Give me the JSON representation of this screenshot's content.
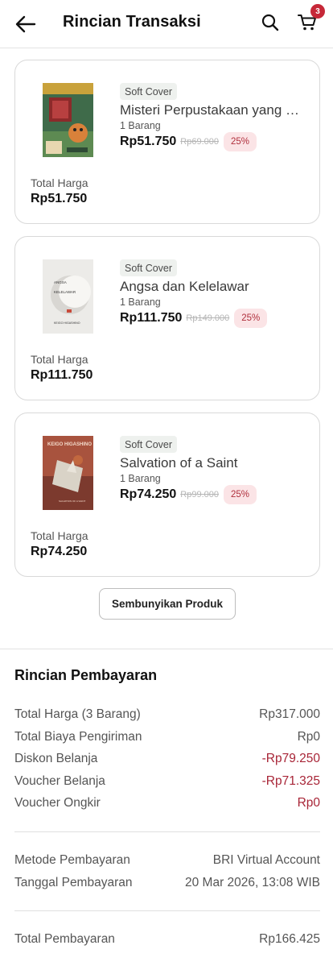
{
  "header": {
    "title": "Rincian Transaksi",
    "cart_count": "3"
  },
  "products": [
    {
      "type_badge": "Soft Cover",
      "title": "Misteri Perpustakaan yang Hilang",
      "qty": "1 Barang",
      "price": "Rp51.750",
      "original_price": "Rp69.000",
      "discount": "25%",
      "total_label": "Total Harga",
      "total_value": "Rp51.750"
    },
    {
      "type_badge": "Soft Cover",
      "title": "Angsa dan Kelelawar",
      "qty": "1 Barang",
      "price": "Rp111.750",
      "original_price": "Rp149.000",
      "discount": "25%",
      "total_label": "Total Harga",
      "total_value": "Rp111.750"
    },
    {
      "type_badge": "Soft Cover",
      "title": "Salvation of a Saint",
      "qty": "1 Barang",
      "price": "Rp74.250",
      "original_price": "Rp99.000",
      "discount": "25%",
      "total_label": "Total Harga",
      "total_value": "Rp74.250"
    }
  ],
  "hide_products_label": "Sembunyikan Produk",
  "payment": {
    "title": "Rincian Pembayaran",
    "rows": [
      {
        "label": "Total Harga (3 Barang)",
        "value": "Rp317.000"
      },
      {
        "label": "Total Biaya Pengiriman",
        "value": "Rp0"
      },
      {
        "label": "Diskon Belanja",
        "value": "-Rp79.250"
      },
      {
        "label": "Voucher Belanja",
        "value": "-Rp71.325"
      },
      {
        "label": "Voucher Ongkir",
        "value": "Rp0"
      }
    ],
    "method_label": "Metode Pembayaran",
    "method_value": "BRI Virtual Account",
    "date_label": "Tanggal Pembayaran",
    "date_value": "20 Mar 2026, 13:08 WIB",
    "total_label": "Total Pembayaran",
    "total_value": "Rp166.425"
  },
  "covers": {
    "book2_title": "ANGSA",
    "book2_sub": "KELELAWAR",
    "book2_author": "KEIGO HIGASHINO",
    "book3_title": "KEIGO HIGASHINO",
    "book3_sub": "SALVATION OF A SAINT"
  },
  "colors": {
    "accent_red": "#a82537",
    "badge_red": "#c62838",
    "discount_bg": "#fbe4e6"
  }
}
